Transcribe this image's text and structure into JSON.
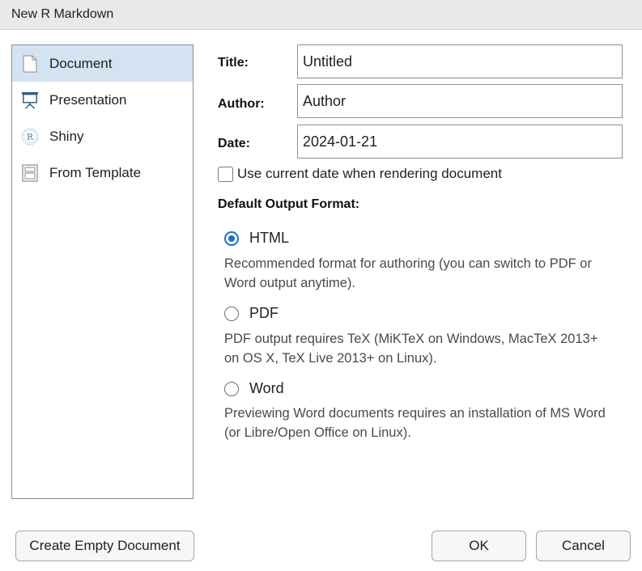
{
  "window": {
    "title": "New R Markdown"
  },
  "sidebar": {
    "items": [
      {
        "label": "Document",
        "icon": "document-icon",
        "selected": true
      },
      {
        "label": "Presentation",
        "icon": "presentation-icon",
        "selected": false
      },
      {
        "label": "Shiny",
        "icon": "shiny-r-icon",
        "selected": false
      },
      {
        "label": "From Template",
        "icon": "template-icon",
        "selected": false
      }
    ]
  },
  "form": {
    "title_label": "Title:",
    "title_value": "Untitled",
    "author_label": "Author:",
    "author_value": "Author",
    "date_label": "Date:",
    "date_value": "2024-01-21",
    "use_current_date_label": "Use current date when rendering document",
    "use_current_date_checked": false
  },
  "output_format": {
    "heading": "Default Output Format:",
    "options": [
      {
        "label": "HTML",
        "checked": true,
        "description": "Recommended format for authoring (you can switch to PDF or Word output anytime)."
      },
      {
        "label": "PDF",
        "checked": false,
        "description": "PDF output requires TeX (MiKTeX on Windows, MacTeX 2013+ on OS X, TeX Live 2013+ on Linux)."
      },
      {
        "label": "Word",
        "checked": false,
        "description": "Previewing Word documents requires an installation of MS Word (or Libre/Open Office on Linux)."
      }
    ]
  },
  "footer": {
    "create_empty_label": "Create Empty Document",
    "ok_label": "OK",
    "cancel_label": "Cancel"
  },
  "colors": {
    "selection_bg": "#d4e3f1",
    "radio_accent": "#1a6fd1"
  }
}
